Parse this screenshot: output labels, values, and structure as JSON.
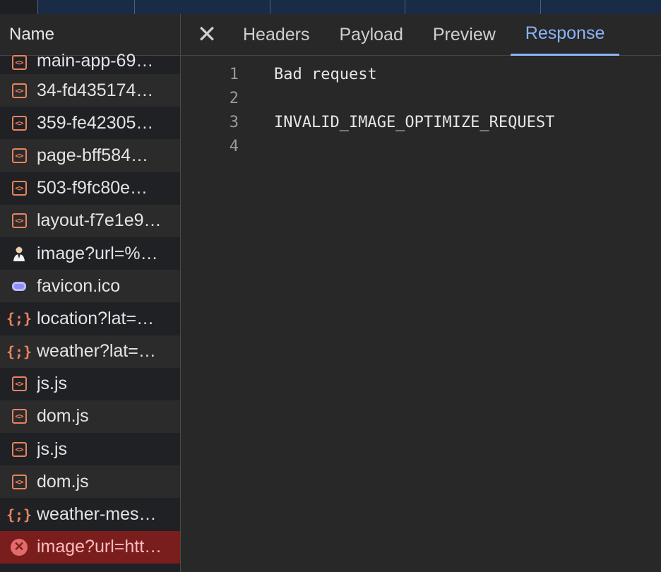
{
  "list_header": "Name",
  "requests": [
    {
      "label": "main-app-69…",
      "icon": "script-icon"
    },
    {
      "label": "34-fd435174…",
      "icon": "script-icon"
    },
    {
      "label": "359-fe42305…",
      "icon": "script-icon"
    },
    {
      "label": "page-bff584…",
      "icon": "script-icon"
    },
    {
      "label": "503-f9fc80e…",
      "icon": "script-icon"
    },
    {
      "label": "layout-f7e1e9…",
      "icon": "script-icon"
    },
    {
      "label": "image?url=%…",
      "icon": "person-image-icon"
    },
    {
      "label": "favicon.ico",
      "icon": "favicon-icon"
    },
    {
      "label": "location?lat=…",
      "icon": "json-icon"
    },
    {
      "label": "weather?lat=…",
      "icon": "json-icon"
    },
    {
      "label": "js.js",
      "icon": "script-icon"
    },
    {
      "label": "dom.js",
      "icon": "script-icon"
    },
    {
      "label": "js.js",
      "icon": "script-icon"
    },
    {
      "label": "dom.js",
      "icon": "script-icon"
    },
    {
      "label": "weather-mes…",
      "icon": "json-icon"
    },
    {
      "label": "image?url=htt…",
      "icon": "error-icon"
    }
  ],
  "tabs": {
    "headers": "Headers",
    "payload": "Payload",
    "preview": "Preview",
    "response": "Response",
    "active": "Response"
  },
  "response": {
    "lines": [
      {
        "num": "1",
        "text": "Bad request"
      },
      {
        "num": "2",
        "text": ""
      },
      {
        "num": "3",
        "text": "INVALID_IMAGE_OPTIMIZE_REQUEST"
      },
      {
        "num": "4",
        "text": ""
      }
    ]
  },
  "colors": {
    "accent": "#8ab4f8",
    "error_row": "#7a1d1d",
    "script_icon": "#e8845e"
  }
}
